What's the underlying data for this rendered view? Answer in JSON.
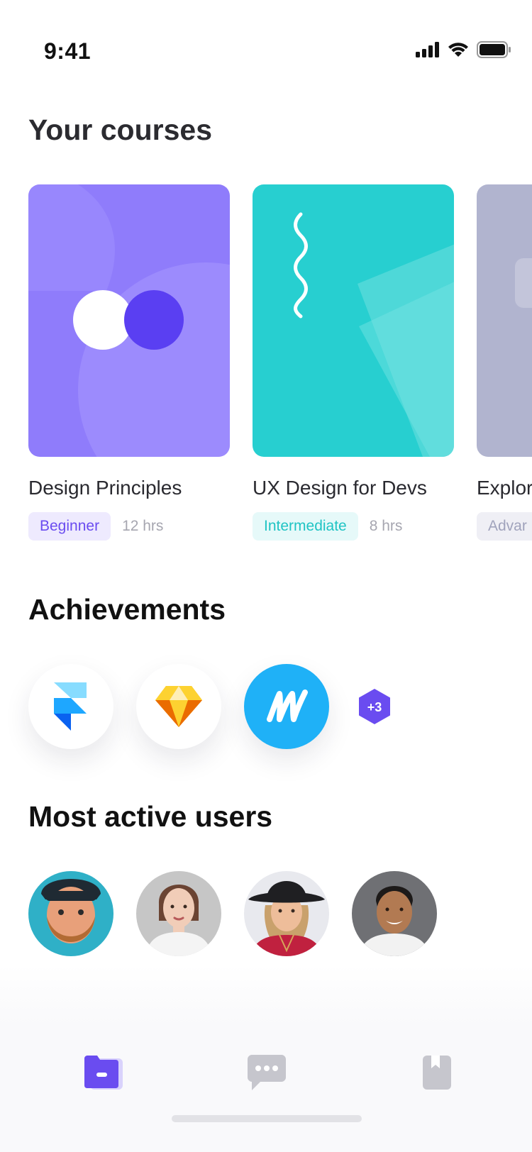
{
  "status_bar": {
    "time": "9:41"
  },
  "courses": {
    "title": "Your courses",
    "items": [
      {
        "name": "Design Principles",
        "level": "Beginner",
        "hours": "12 hrs",
        "color": "#8f7cfb",
        "badge_bg": "#eeeafe",
        "badge_color": "#6a4cf0"
      },
      {
        "name": "UX Design for Devs",
        "level": "Intermediate",
        "hours": "8 hrs",
        "color": "#27cfd0",
        "badge_bg": "#e6f9f9",
        "badge_color": "#20c4c4"
      },
      {
        "name": "Explor",
        "level": "Advar",
        "hours": "",
        "color": "#b1b4cf",
        "badge_bg": "#efeff5",
        "badge_color": "#a0a3bc"
      }
    ]
  },
  "achievements": {
    "title": "Achievements",
    "items": [
      {
        "icon": "framer-icon"
      },
      {
        "icon": "sketch-icon"
      },
      {
        "icon": "marvel-icon"
      }
    ],
    "more_label": "+3"
  },
  "users": {
    "title": "Most active users",
    "items": [
      {
        "avatar": "avatar-bearded-man"
      },
      {
        "avatar": "avatar-woman-lace"
      },
      {
        "avatar": "avatar-woman-hat"
      },
      {
        "avatar": "avatar-man-smiling"
      }
    ]
  },
  "tab_bar": {
    "items": [
      {
        "icon": "folder-icon",
        "active": true
      },
      {
        "icon": "chat-icon",
        "active": false
      },
      {
        "icon": "bookmark-icon",
        "active": false
      }
    ],
    "active_color": "#6a4cf0",
    "inactive_color": "#c6c6cd"
  }
}
